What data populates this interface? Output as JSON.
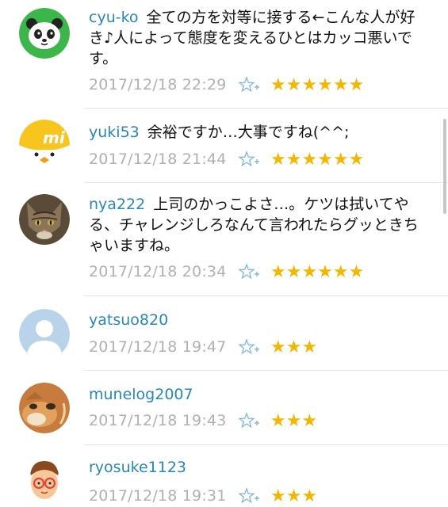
{
  "comments": [
    {
      "username": "cyu-ko",
      "text": "全ての方を対等に接する←こんな人が好き♪人によって態度を変えるひとはカッコ悪いです。",
      "timestamp": "2017/12/18 22:29",
      "rating": "★★★★★★"
    },
    {
      "username": "yuki53",
      "text": "余裕ですか…大事ですね(^^;",
      "timestamp": "2017/12/18 21:44",
      "rating": "★★★★★★"
    },
    {
      "username": "nya222",
      "text": "上司のかっこよさ…。ケツは拭いてやる、チャレンジしろなんて言われたらグッときちゃいますね。",
      "timestamp": "2017/12/18 20:34",
      "rating": "★★★★★★"
    },
    {
      "username": "yatsuo820",
      "text": "",
      "timestamp": "2017/12/18 19:47",
      "rating": "★★★"
    },
    {
      "username": "munelog2007",
      "text": "",
      "timestamp": "2017/12/18 19:43",
      "rating": "★★★"
    },
    {
      "username": "ryosuke1123",
      "text": "",
      "timestamp": "2017/12/18 19:31",
      "rating": "★★★"
    }
  ],
  "icons": {
    "favorite": "star-plus-icon"
  },
  "colors": {
    "username": "#2a86b8",
    "timestamp": "#b0b0b0",
    "star": "#f2b705",
    "divider": "#e4e4e4"
  }
}
